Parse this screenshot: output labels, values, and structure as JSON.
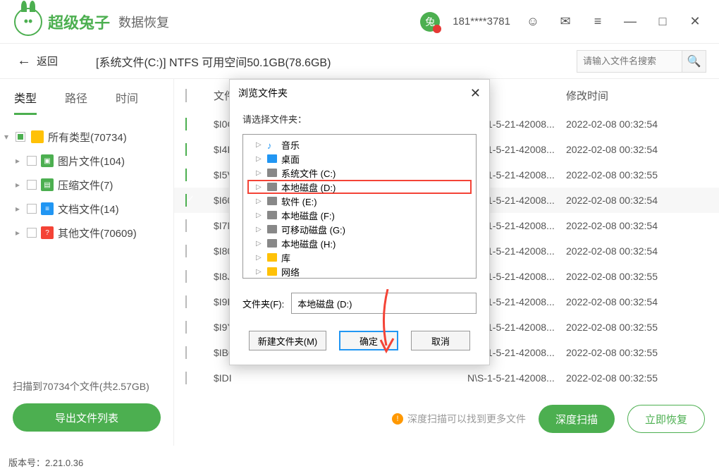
{
  "header": {
    "app_name": "超级兔子",
    "app_sub": "数据恢复",
    "phone": "181****3781"
  },
  "subheader": {
    "back": "返回",
    "path": "[系统文件(C:)] NTFS 可用空间50.1GB(78.6GB)",
    "search_placeholder": "请输入文件名搜索"
  },
  "sidebar": {
    "tabs": {
      "type": "类型",
      "path": "路径",
      "time": "时间"
    },
    "items": [
      {
        "label": "所有类型(70734)"
      },
      {
        "label": "图片文件(104)"
      },
      {
        "label": "压缩文件(7)"
      },
      {
        "label": "文档文件(14)"
      },
      {
        "label": "其他文件(70609)"
      }
    ],
    "scan_text": "扫描到70734个文件(共2.57GB)",
    "export_btn": "导出文件列表"
  },
  "table": {
    "hdr_name": "文件",
    "hdr_time": "修改时间",
    "rows": [
      {
        "checked": true,
        "name": "$I0C",
        "path": "N\\S-1-5-21-42008...",
        "time": "2022-02-08 00:32:54"
      },
      {
        "checked": true,
        "name": "$I4L",
        "path": "N\\S-1-5-21-42008...",
        "time": "2022-02-08 00:32:54"
      },
      {
        "checked": true,
        "name": "$I5V",
        "path": "N\\S-1-5-21-42008...",
        "time": "2022-02-08 00:32:55"
      },
      {
        "checked": true,
        "name": "$I60",
        "path": "N\\S-1-5-21-42008...",
        "time": "2022-02-08 00:32:54"
      },
      {
        "checked": false,
        "name": "$I7N",
        "path": "N\\S-1-5-21-42008...",
        "time": "2022-02-08 00:32:54"
      },
      {
        "checked": false,
        "name": "$I80",
        "path": "N\\S-1-5-21-42008...",
        "time": "2022-02-08 00:32:54"
      },
      {
        "checked": false,
        "name": "$I8J",
        "path": "N\\S-1-5-21-42008...",
        "time": "2022-02-08 00:32:55"
      },
      {
        "checked": false,
        "name": "$I9F",
        "path": "N\\S-1-5-21-42008...",
        "time": "2022-02-08 00:32:54"
      },
      {
        "checked": false,
        "name": "$I9Y",
        "path": "N\\S-1-5-21-42008...",
        "time": "2022-02-08 00:32:55"
      },
      {
        "checked": false,
        "name": "$IB0",
        "path": "N\\S-1-5-21-42008...",
        "time": "2022-02-08 00:32:55"
      },
      {
        "checked": false,
        "name": "$IDI",
        "path": "N\\S-1-5-21-42008...",
        "time": "2022-02-08 00:32:55"
      }
    ]
  },
  "bottom": {
    "tip": "深度扫描可以找到更多文件",
    "deep": "深度扫描",
    "restore": "立即恢复"
  },
  "dialog": {
    "title": "浏览文件夹",
    "select_label": "请选择文件夹：",
    "items": [
      {
        "label": "音乐",
        "icon": "music"
      },
      {
        "label": "桌面",
        "icon": "desktop"
      },
      {
        "label": "系统文件 (C:)",
        "icon": "drive"
      },
      {
        "label": "本地磁盘 (D:)",
        "icon": "drive",
        "hl": true
      },
      {
        "label": "软件 (E:)",
        "icon": "drive"
      },
      {
        "label": "本地磁盘 (F:)",
        "icon": "drive"
      },
      {
        "label": "可移动磁盘 (G:)",
        "icon": "drive"
      },
      {
        "label": "本地磁盘 (H:)",
        "icon": "drive"
      },
      {
        "label": "库",
        "icon": "lib"
      },
      {
        "label": "网络",
        "icon": "lib"
      }
    ],
    "folder_label": "文件夹(F):",
    "folder_value": "本地磁盘 (D:)",
    "new_folder": "新建文件夹(M)",
    "ok": "确定",
    "cancel": "取消"
  },
  "version_label": "版本号：",
  "version": "2.21.0.36"
}
